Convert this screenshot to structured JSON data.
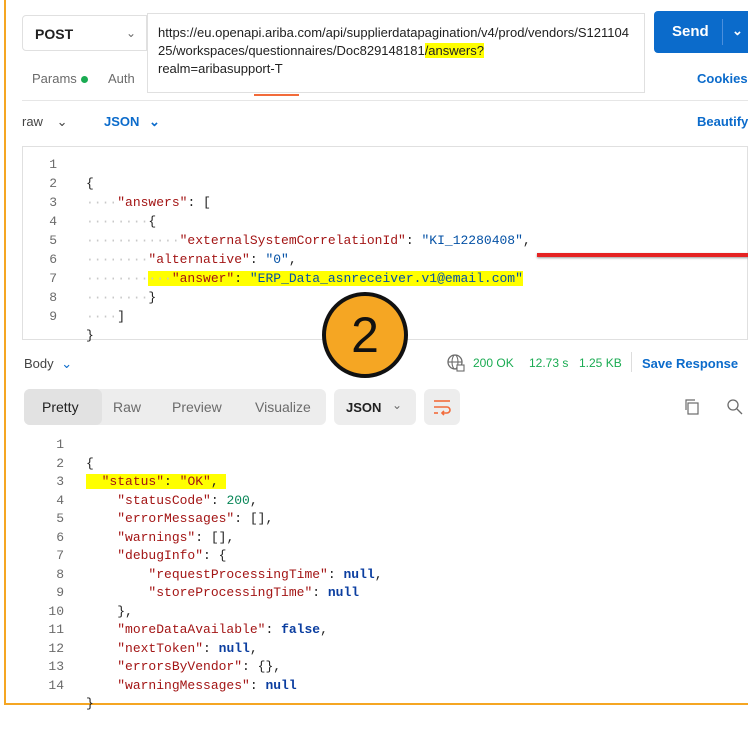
{
  "request": {
    "method": "POST",
    "url_part1": "https://eu.openapi.ariba.com/api/supplierdatapagination/v4/prod/vendors/S12110425/workspaces/questionnaires/Doc829148181",
    "url_highlight": "/answers?",
    "url_part2": "realm=aribasupport-T",
    "send_label": "Send"
  },
  "request_tabs": {
    "params": "Params",
    "auth": "Auth",
    "cookies": "Cookies"
  },
  "body_options": {
    "mode": "raw",
    "format": "JSON",
    "beautify": "Beautify"
  },
  "request_body": {
    "line_numbers": [
      "1",
      "2",
      "3",
      "4",
      "5",
      "6",
      "7",
      "8",
      "9"
    ],
    "l2_key": "\"answers\"",
    "l4_key": "\"externalSystemCorrelationId\"",
    "l4_val": "\"KI_12280408\"",
    "l5_key": "\"alternative\"",
    "l5_val": "\"0\"",
    "l6_key": "\"answer\"",
    "l6_val": "\"ERP_Data_asnreceiver.v1@email.com\""
  },
  "annotation": {
    "step": "2"
  },
  "response_bar": {
    "body_label": "Body",
    "status": "200 OK",
    "time": "12.73 s",
    "size": "1.25 KB",
    "save": "Save Response"
  },
  "response_tabs": {
    "pretty": "Pretty",
    "raw": "Raw",
    "preview": "Preview",
    "visualize": "Visualize",
    "format": "JSON"
  },
  "response_body": {
    "line_numbers": [
      "1",
      "2",
      "3",
      "4",
      "5",
      "6",
      "7",
      "8",
      "9",
      "10",
      "11",
      "12",
      "13",
      "14"
    ],
    "status_key": "\"status\"",
    "status_val": "\"OK\"",
    "statusCode_key": "\"statusCode\"",
    "statusCode_val": "200",
    "errorMessages_key": "\"errorMessages\"",
    "warnings_key": "\"warnings\"",
    "debugInfo_key": "\"debugInfo\"",
    "rpt_key": "\"requestProcessingTime\"",
    "spt_key": "\"storeProcessingTime\"",
    "more_key": "\"moreDataAvailable\"",
    "more_val": "false",
    "next_key": "\"nextToken\"",
    "ebv_key": "\"errorsByVendor\"",
    "wm_key": "\"warningMessages\"",
    "null": "null"
  },
  "colors": {
    "accent": "#0b6bcb",
    "highlight": "#ffff00",
    "annotation": "#f5a623",
    "arrow": "#e52222",
    "status_ok": "#1aab52"
  }
}
